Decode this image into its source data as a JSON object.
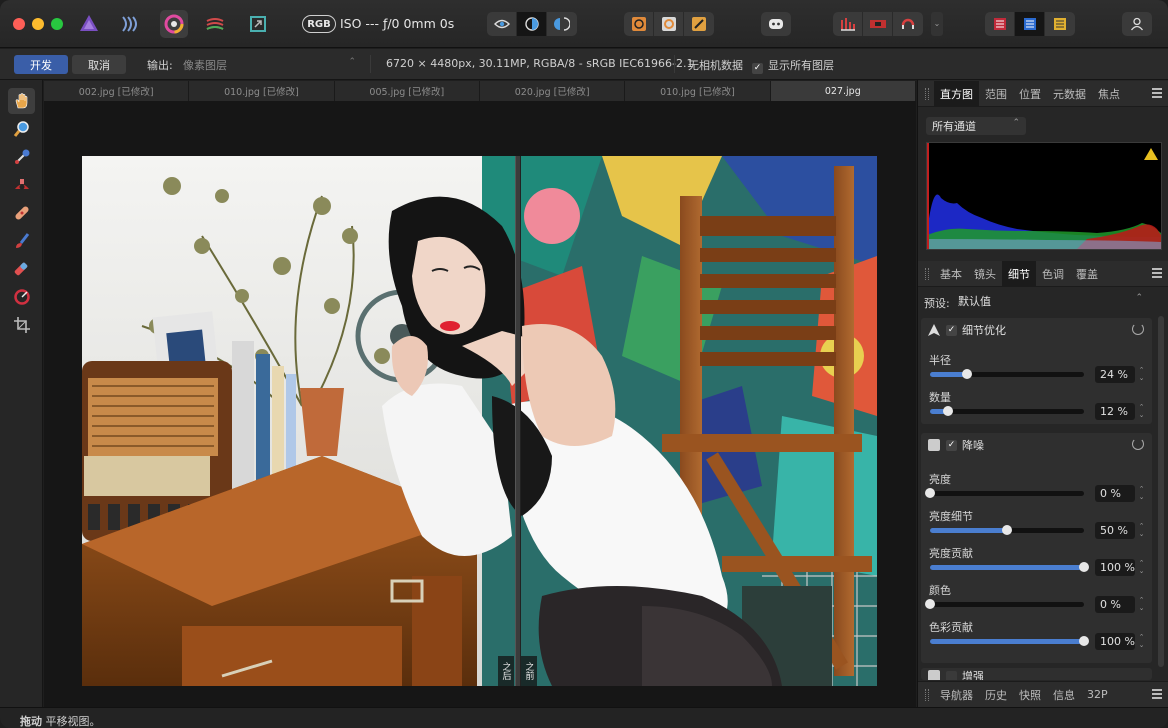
{
  "titlebar": {
    "rgb_label": "RGB",
    "exif_text": "ISO --- ƒ/0 0mm 0s"
  },
  "context": {
    "develop_label": "开发",
    "cancel_label": "取消",
    "output_label": "输出:",
    "output_value": "像素图层",
    "image_info": "6720 × 4480px, 30.11MP, RGBA/8 - sRGB IEC61966-2.1",
    "no_camera": "无相机数据",
    "show_all_layers": "显示所有图层"
  },
  "doc_tabs": [
    "002.jpg [已修改]",
    "010.jpg [已修改]",
    "005.jpg [已修改]",
    "020.jpg [已修改]",
    "010.jpg [已修改]",
    "027.jpg"
  ],
  "canvas": {
    "after_label": "之后",
    "before_label": "之前"
  },
  "top_panel": {
    "tabs": [
      "直方图",
      "范围",
      "位置",
      "元数据",
      "焦点"
    ],
    "channel_select": "所有通道"
  },
  "mid_panel": {
    "tabs": [
      "基本",
      "镜头",
      "细节",
      "色调",
      "覆盖"
    ],
    "preset_label": "预设:",
    "preset_value": "默认值"
  },
  "detail_group": {
    "title": "细节优化",
    "sliders": [
      {
        "label": "半径",
        "value": "24 %",
        "pct": 0.24
      },
      {
        "label": "数量",
        "value": "12 %",
        "pct": 0.12
      }
    ]
  },
  "noise_group": {
    "title": "降噪",
    "sliders": [
      {
        "label": "亮度",
        "value": "0 %",
        "pct": 0
      },
      {
        "label": "亮度细节",
        "value": "50 %",
        "pct": 0.5
      },
      {
        "label": "亮度贡献",
        "value": "100 %",
        "pct": 1
      },
      {
        "label": "颜色",
        "value": "0 %",
        "pct": 0
      },
      {
        "label": "色彩贡献",
        "value": "100 %",
        "pct": 1
      }
    ]
  },
  "next_group_title": "增强",
  "bottom_tabs": [
    "导航器",
    "历史",
    "快照",
    "信息",
    "32P"
  ],
  "status": {
    "tool": "拖动",
    "hint": " 平移视图。"
  }
}
